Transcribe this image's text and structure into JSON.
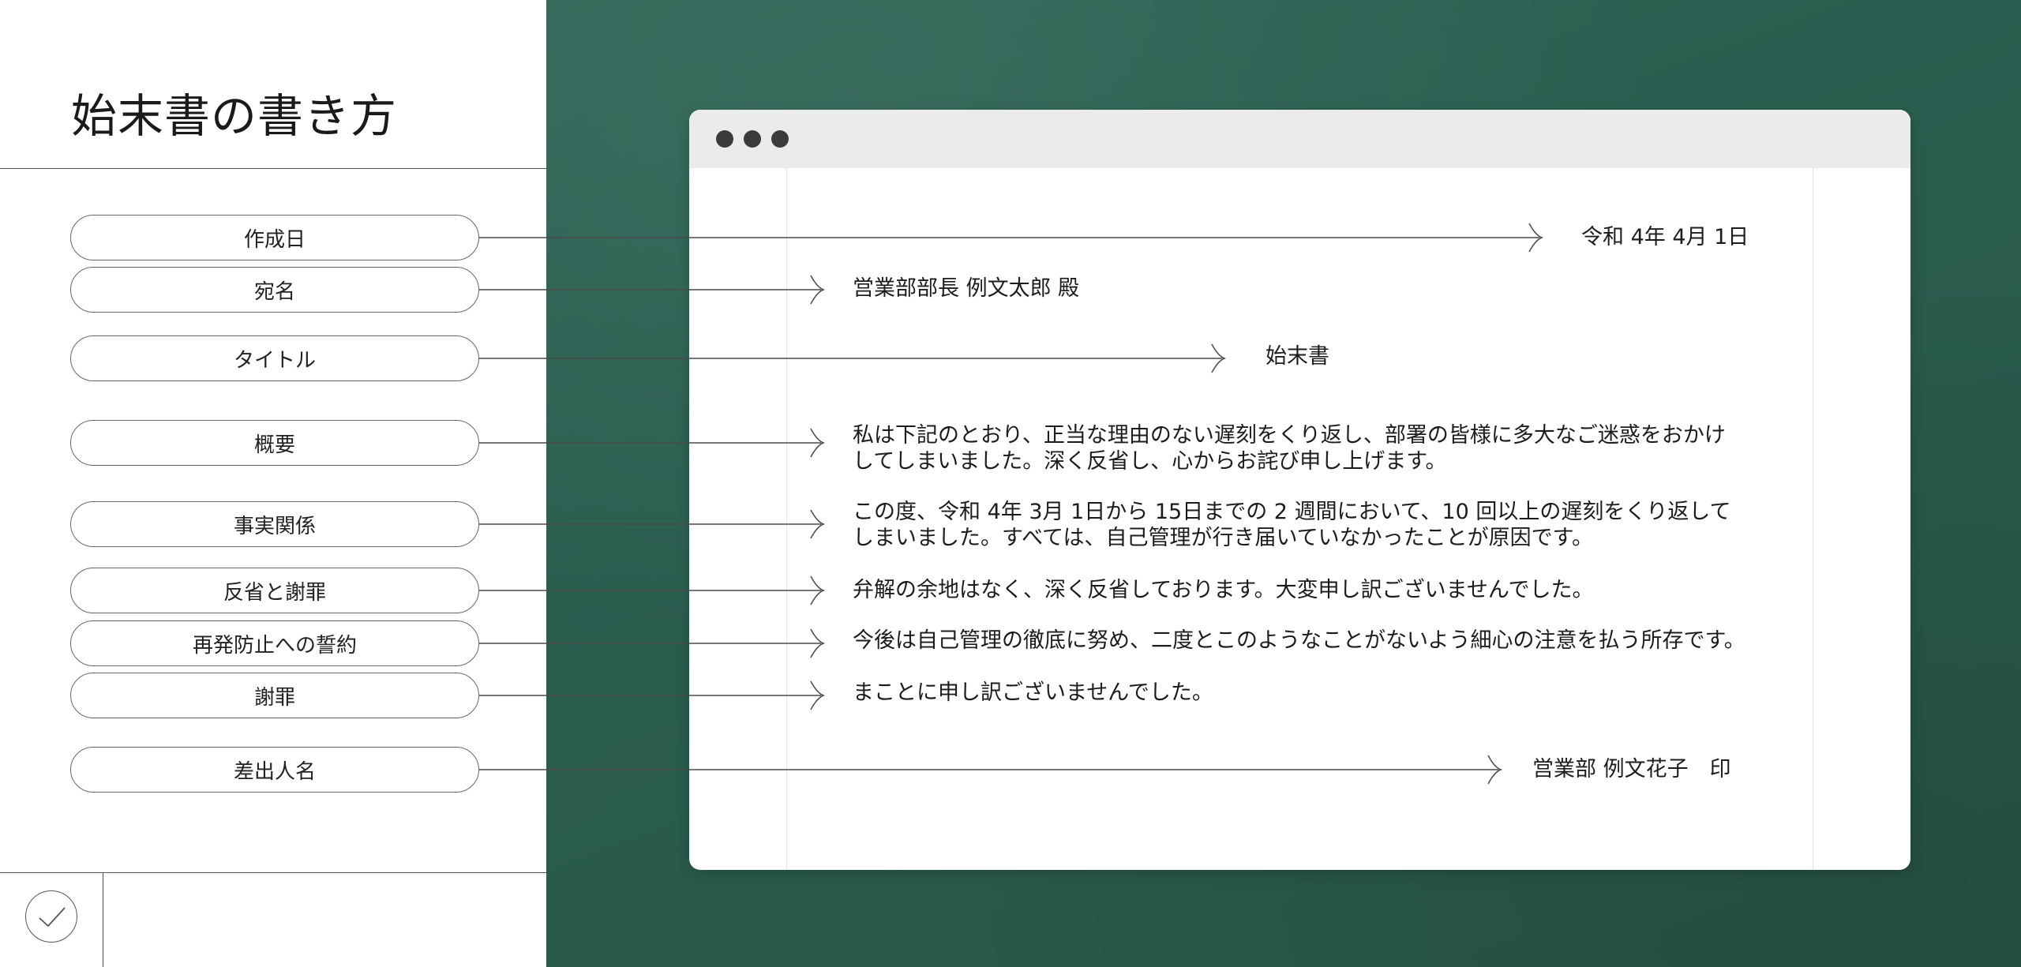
{
  "title": "始末書の書き方",
  "labels": [
    {
      "key": "date",
      "label": "作成日"
    },
    {
      "key": "recipient",
      "label": "宛名"
    },
    {
      "key": "title",
      "label": "タイトル"
    },
    {
      "key": "summary",
      "label": "概要"
    },
    {
      "key": "facts",
      "label": "事実関係"
    },
    {
      "key": "reflection",
      "label": "反省と謝罪"
    },
    {
      "key": "pledge",
      "label": "再発防止への誓約"
    },
    {
      "key": "apology",
      "label": "謝罪"
    },
    {
      "key": "sender",
      "label": "差出人名"
    }
  ],
  "document": {
    "date": "令和 4年 4月 1日",
    "recipient": "営業部部長 例文太郎 殿",
    "title": "始末書",
    "summary": "私は下記のとおり、正当な理由のない遅刻をくり返し、部署の皆様に多大なご迷惑をおかけしてしまいました。深く反省し、心からお詫び申し上げます。",
    "facts": "この度、令和 4年 3月 1日から 15日までの 2 週間において、10 回以上の遅刻をくり返してしまいました。すべては、自己管理が行き届いていなかったことが原因です。",
    "reflection": "弁解の余地はなく、深く反省しております。大変申し訳ございませんでした。",
    "pledge": "今後は自己管理の徹底に努め、二度とこのようなことがないよう細心の注意を払う所存です。",
    "apology": "まことに申し訳ございませんでした。",
    "sender": "営業部 例文花子　印"
  },
  "colors": {
    "board": "#2a5c4e",
    "window_bar": "#ebebeb",
    "line": "#555555"
  },
  "icons": {
    "footer": "check-circle-icon",
    "window_controls": "window-dots-icon"
  }
}
